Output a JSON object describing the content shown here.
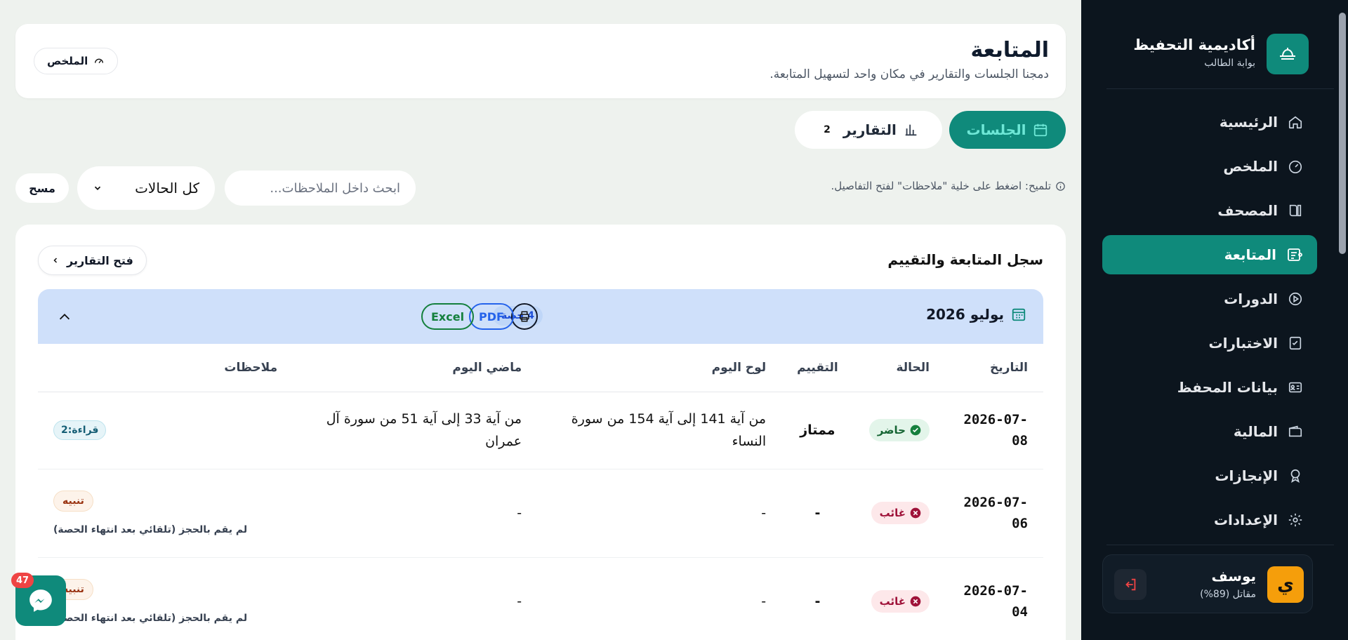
{
  "sidebar": {
    "brand_name": "أكاديمية التحفيظ",
    "brand_sub": "بوابة الطالب",
    "items": [
      {
        "label": "الرئيسية",
        "icon": "home-icon"
      },
      {
        "label": "الملخص",
        "icon": "gauge-icon"
      },
      {
        "label": "المصحف",
        "icon": "book-icon"
      },
      {
        "label": "المتابعة",
        "icon": "tracking-icon",
        "active": true
      },
      {
        "label": "الدورات",
        "icon": "play-circle-icon"
      },
      {
        "label": "الاختبارات",
        "icon": "checklist-icon"
      },
      {
        "label": "بيانات المحفظ",
        "icon": "id-card-icon"
      },
      {
        "label": "المالية",
        "icon": "wallet-icon"
      },
      {
        "label": "الإنجازات",
        "icon": "award-icon"
      },
      {
        "label": "الإعدادات",
        "icon": "gear-icon"
      }
    ],
    "user": {
      "initial": "ي",
      "name": "يوسف",
      "role": "مقاتل (89%)"
    }
  },
  "header": {
    "title": "المتابعة",
    "subtitle": "دمجنا الجلسات والتقارير في مكان واحد لتسهيل المتابعة.",
    "summary_button": "الملخص"
  },
  "tabs": {
    "sessions": "الجلسات",
    "reports": "التقارير",
    "reports_count": "2"
  },
  "filters": {
    "hint": "تلميح: اضغط على خلية \"ملاحظات\" لفتح التفاصيل.",
    "search_placeholder": "ابحث داخل الملاحظات...",
    "status_value": "كل الحالات",
    "clear_label": "مسح"
  },
  "log": {
    "title": "سجل المتابعة والتقييم",
    "open_reports": "فتح التقارير",
    "month": "يوليو 2026",
    "sessions_count": "4 حصة",
    "pdf": "PDF",
    "excel": "Excel",
    "columns": [
      "التاريخ",
      "الحالة",
      "التقييم",
      "لوح اليوم",
      "ماضي اليوم",
      "ملاحظات"
    ],
    "rows": [
      {
        "date": "2026-07-08",
        "status": "حاضر",
        "status_type": "present",
        "grade": "ممتاز",
        "today": "من آية 141 إلى آية 154 من سورة النساء",
        "past": "من آية 33 إلى آية 51 من سورة آل عمران",
        "note_badge": "قراءة:2",
        "note_text": ""
      },
      {
        "date": "2026-07-06",
        "status": "غائب",
        "status_type": "absent",
        "grade": "-",
        "today": "-",
        "past": "-",
        "note_badge": "تنبيه",
        "note_text": "لم يقم بالحجز (تلقائي بعد انتهاء الحصة)"
      },
      {
        "date": "2026-07-04",
        "status": "غائب",
        "status_type": "absent",
        "grade": "-",
        "today": "-",
        "past": "-",
        "note_badge": "تنبيه",
        "note_text": "لم يقم بالحجز (تلقائي بعد انتهاء الحصة)"
      }
    ]
  },
  "chat": {
    "count": "47"
  },
  "colors": {
    "accent": "#0f8a7b",
    "sidebar": "#0c151e",
    "month_bar": "#cfe0fa"
  }
}
